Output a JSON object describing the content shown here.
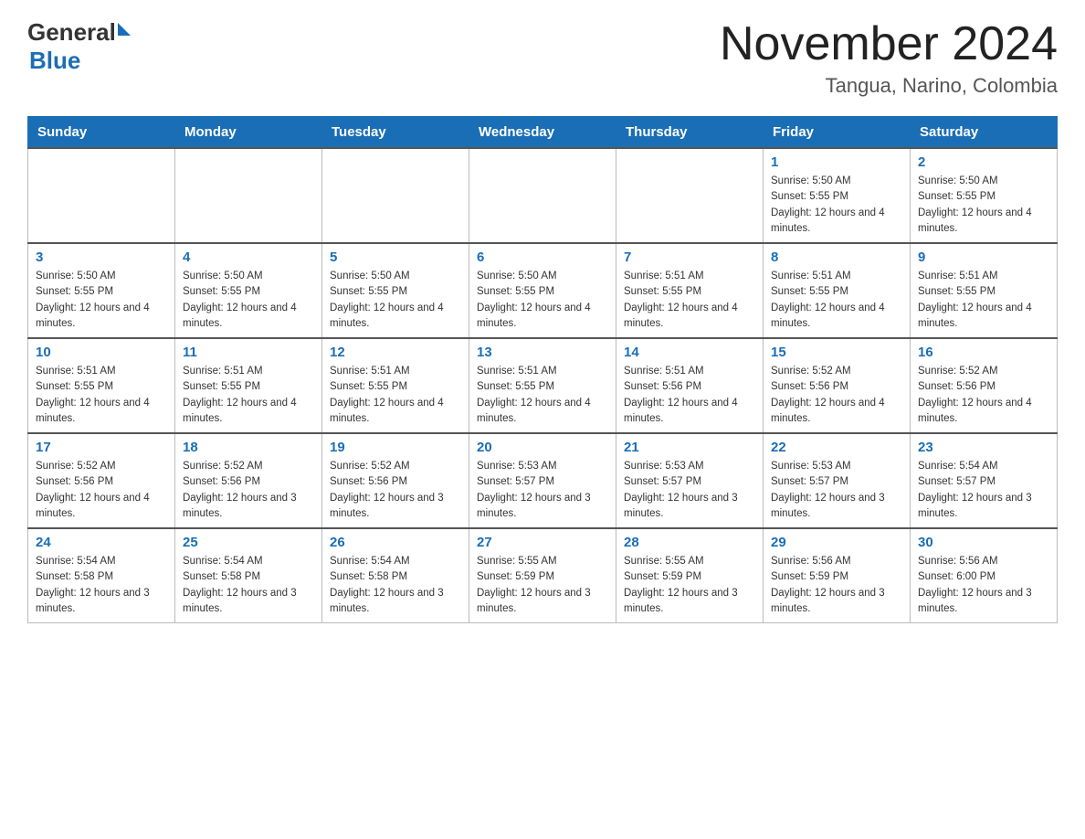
{
  "header": {
    "logo": {
      "general": "General",
      "triangle": "",
      "blue": "Blue"
    },
    "title": "November 2024",
    "location": "Tangua, Narino, Colombia"
  },
  "days_of_week": [
    "Sunday",
    "Monday",
    "Tuesday",
    "Wednesday",
    "Thursday",
    "Friday",
    "Saturday"
  ],
  "weeks": [
    [
      {
        "day": "",
        "info": ""
      },
      {
        "day": "",
        "info": ""
      },
      {
        "day": "",
        "info": ""
      },
      {
        "day": "",
        "info": ""
      },
      {
        "day": "",
        "info": ""
      },
      {
        "day": "1",
        "info": "Sunrise: 5:50 AM\nSunset: 5:55 PM\nDaylight: 12 hours and 4 minutes."
      },
      {
        "day": "2",
        "info": "Sunrise: 5:50 AM\nSunset: 5:55 PM\nDaylight: 12 hours and 4 minutes."
      }
    ],
    [
      {
        "day": "3",
        "info": "Sunrise: 5:50 AM\nSunset: 5:55 PM\nDaylight: 12 hours and 4 minutes."
      },
      {
        "day": "4",
        "info": "Sunrise: 5:50 AM\nSunset: 5:55 PM\nDaylight: 12 hours and 4 minutes."
      },
      {
        "day": "5",
        "info": "Sunrise: 5:50 AM\nSunset: 5:55 PM\nDaylight: 12 hours and 4 minutes."
      },
      {
        "day": "6",
        "info": "Sunrise: 5:50 AM\nSunset: 5:55 PM\nDaylight: 12 hours and 4 minutes."
      },
      {
        "day": "7",
        "info": "Sunrise: 5:51 AM\nSunset: 5:55 PM\nDaylight: 12 hours and 4 minutes."
      },
      {
        "day": "8",
        "info": "Sunrise: 5:51 AM\nSunset: 5:55 PM\nDaylight: 12 hours and 4 minutes."
      },
      {
        "day": "9",
        "info": "Sunrise: 5:51 AM\nSunset: 5:55 PM\nDaylight: 12 hours and 4 minutes."
      }
    ],
    [
      {
        "day": "10",
        "info": "Sunrise: 5:51 AM\nSunset: 5:55 PM\nDaylight: 12 hours and 4 minutes."
      },
      {
        "day": "11",
        "info": "Sunrise: 5:51 AM\nSunset: 5:55 PM\nDaylight: 12 hours and 4 minutes."
      },
      {
        "day": "12",
        "info": "Sunrise: 5:51 AM\nSunset: 5:55 PM\nDaylight: 12 hours and 4 minutes."
      },
      {
        "day": "13",
        "info": "Sunrise: 5:51 AM\nSunset: 5:55 PM\nDaylight: 12 hours and 4 minutes."
      },
      {
        "day": "14",
        "info": "Sunrise: 5:51 AM\nSunset: 5:56 PM\nDaylight: 12 hours and 4 minutes."
      },
      {
        "day": "15",
        "info": "Sunrise: 5:52 AM\nSunset: 5:56 PM\nDaylight: 12 hours and 4 minutes."
      },
      {
        "day": "16",
        "info": "Sunrise: 5:52 AM\nSunset: 5:56 PM\nDaylight: 12 hours and 4 minutes."
      }
    ],
    [
      {
        "day": "17",
        "info": "Sunrise: 5:52 AM\nSunset: 5:56 PM\nDaylight: 12 hours and 4 minutes."
      },
      {
        "day": "18",
        "info": "Sunrise: 5:52 AM\nSunset: 5:56 PM\nDaylight: 12 hours and 3 minutes."
      },
      {
        "day": "19",
        "info": "Sunrise: 5:52 AM\nSunset: 5:56 PM\nDaylight: 12 hours and 3 minutes."
      },
      {
        "day": "20",
        "info": "Sunrise: 5:53 AM\nSunset: 5:57 PM\nDaylight: 12 hours and 3 minutes."
      },
      {
        "day": "21",
        "info": "Sunrise: 5:53 AM\nSunset: 5:57 PM\nDaylight: 12 hours and 3 minutes."
      },
      {
        "day": "22",
        "info": "Sunrise: 5:53 AM\nSunset: 5:57 PM\nDaylight: 12 hours and 3 minutes."
      },
      {
        "day": "23",
        "info": "Sunrise: 5:54 AM\nSunset: 5:57 PM\nDaylight: 12 hours and 3 minutes."
      }
    ],
    [
      {
        "day": "24",
        "info": "Sunrise: 5:54 AM\nSunset: 5:58 PM\nDaylight: 12 hours and 3 minutes."
      },
      {
        "day": "25",
        "info": "Sunrise: 5:54 AM\nSunset: 5:58 PM\nDaylight: 12 hours and 3 minutes."
      },
      {
        "day": "26",
        "info": "Sunrise: 5:54 AM\nSunset: 5:58 PM\nDaylight: 12 hours and 3 minutes."
      },
      {
        "day": "27",
        "info": "Sunrise: 5:55 AM\nSunset: 5:59 PM\nDaylight: 12 hours and 3 minutes."
      },
      {
        "day": "28",
        "info": "Sunrise: 5:55 AM\nSunset: 5:59 PM\nDaylight: 12 hours and 3 minutes."
      },
      {
        "day": "29",
        "info": "Sunrise: 5:56 AM\nSunset: 5:59 PM\nDaylight: 12 hours and 3 minutes."
      },
      {
        "day": "30",
        "info": "Sunrise: 5:56 AM\nSunset: 6:00 PM\nDaylight: 12 hours and 3 minutes."
      }
    ]
  ]
}
